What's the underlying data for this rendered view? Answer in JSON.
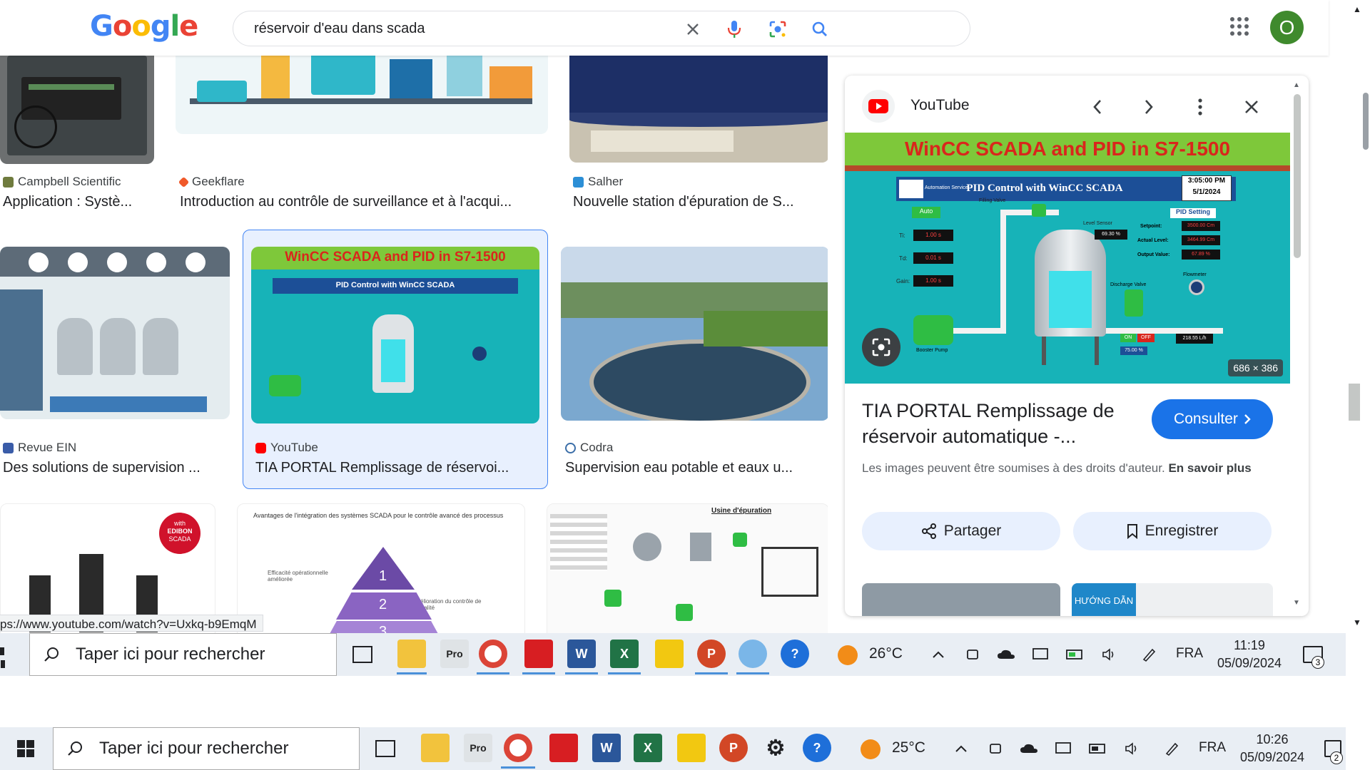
{
  "search": {
    "query": "réservoir d'eau dans scada"
  },
  "account": {
    "initial": "O"
  },
  "results": [
    {
      "source": "Campbell Scientific",
      "title": "Application : Systè..."
    },
    {
      "source": "Geekflare",
      "title": "Introduction au contrôle de surveillance et à l'acqui..."
    },
    {
      "source": "Salher",
      "title": "Nouvelle station d'épuration de S..."
    },
    {
      "source": "Revue EIN",
      "title": "Des solutions de supervision ..."
    },
    {
      "source": "YouTube",
      "title": "TIA PORTAL Remplissage de réservoi..."
    },
    {
      "source": "Codra",
      "title": "Supervision eau potable et eaux u..."
    }
  ],
  "row3": {
    "edibon_badge_1": "with",
    "edibon_badge_2": "EDIBON",
    "edibon_badge_3": "SCADA",
    "pyramid_heading": "Avantages de l'intégration des systèmes SCADA pour le contrôle avancé des processus",
    "pyramid_left": "Efficacité opérationnelle améliorée",
    "pyramid_right": "Amélioration du contrôle de la qualité",
    "pyramid_n1": "1",
    "pyramid_n2": "2",
    "pyramid_n3": "3",
    "usine_title": "Usine d'épuration"
  },
  "thumb_scada": {
    "banner": "WinCC SCADA and PID in S7-1500",
    "header": "PID Control with WinCC SCADA",
    "time": "3:05:00 PM",
    "date": "5/1/2024",
    "auto": "Auto",
    "pid_setting": "PID Setting",
    "setpoint_label": "Setpoint:",
    "setpoint_val": "3500.00 Cm",
    "actual_label": "Actual Level:",
    "actual_val": "3464.99 Cm",
    "output_label": "Output Value:",
    "output_val": "67.89 %",
    "ti_label": "Ti:",
    "ti_val": "1.00 s",
    "td_label": "Td:",
    "td_val": "0.01 s",
    "gain_label": "Gain:",
    "gain_val": "1.00 s",
    "filling_valve": "Filling Valve",
    "level_sensor": "Level Sensor",
    "level_pct": "69.30 %",
    "discharge_valve": "Discharge Valve",
    "flowmeter": "Flowmeter",
    "on": "ON",
    "off": "OFF",
    "flow_val": "218.55 L/h",
    "valve_pct": "75.00 %",
    "booster": "Booster Pump",
    "company": "Automation Service"
  },
  "panel": {
    "source": "YouTube",
    "dimensions": "686 × 386",
    "title": "TIA PORTAL Remplissage de réservoir automatique -...",
    "consult": "Consulter",
    "rights_text": "Les images peuvent être soumises à des droits d'auteur.",
    "rights_link": "En savoir plus",
    "share": "Partager",
    "save": "Enregistrer",
    "preview_label": "HƯỚNG DẪN"
  },
  "status_url": "ps://www.youtube.com/watch?v=Uxkq-b9EmqM",
  "taskbar_top": {
    "search": "Taper ici pour rechercher",
    "temp": "26°C",
    "lang": "FRA",
    "time": "11:19",
    "date": "05/09/2024",
    "notif": "3"
  },
  "taskbar_bottom": {
    "search": "Taper ici pour rechercher",
    "temp": "25°C",
    "lang": "FRA",
    "time": "10:26",
    "date": "05/09/2024",
    "notif": "2"
  },
  "app_letters": {
    "pro": "Pro",
    "word": "W",
    "excel": "X",
    "ppt": "P",
    "help": "?"
  },
  "colors": {
    "accent": "#1a73e8",
    "avatar": "#3f8a2d",
    "scada_teal": "#17b3b8",
    "banner_green": "#7ec83a",
    "banner_red": "#d9261c"
  }
}
